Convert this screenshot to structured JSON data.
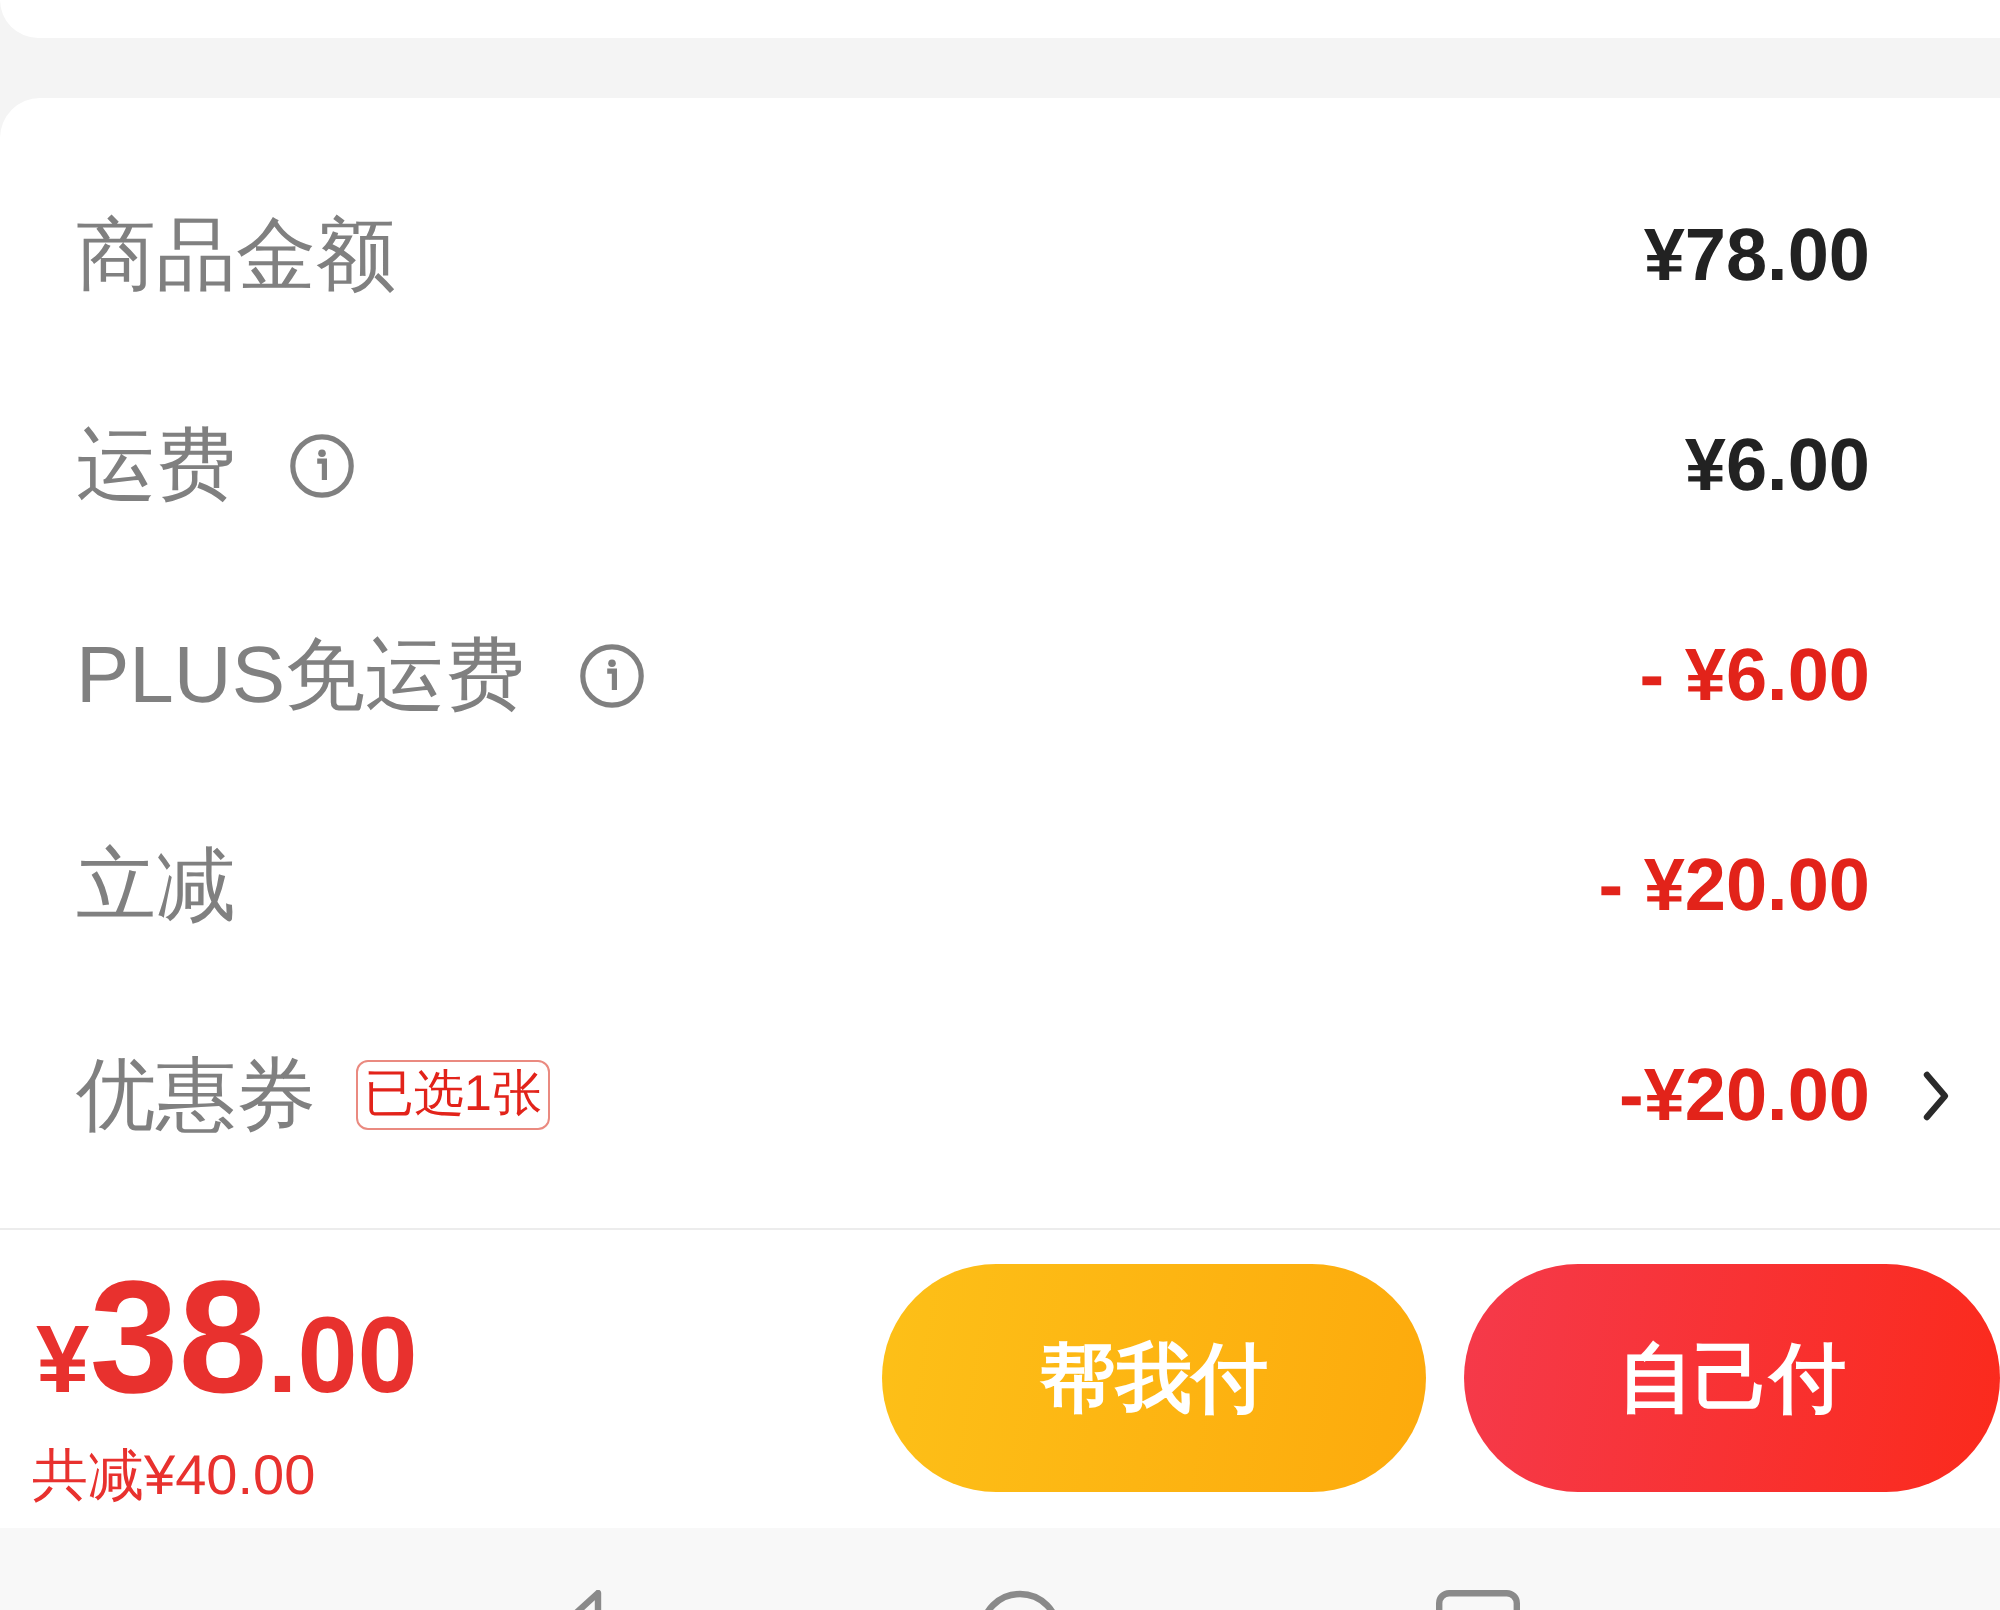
{
  "summary": {
    "rows": [
      {
        "label": "商品金额",
        "info": false,
        "value": "¥78.00",
        "kind": "amount",
        "arrow": false
      },
      {
        "label": "运费",
        "info": true,
        "value": "¥6.00",
        "kind": "amount",
        "arrow": false
      },
      {
        "label": "PLUS免运费",
        "info": true,
        "value": "- ¥6.00",
        "kind": "deduction",
        "arrow": false
      },
      {
        "label": "立减",
        "info": false,
        "value": "- ¥20.00",
        "kind": "deduction",
        "arrow": false
      },
      {
        "label": "优惠券",
        "info": false,
        "badge": "已选1张",
        "value": "-¥20.00",
        "kind": "deduction",
        "arrow": true
      }
    ]
  },
  "checkout": {
    "total": {
      "currency": "¥",
      "integer": "38",
      "decimals": ".00"
    },
    "saving": "共减¥40.00",
    "buttons": [
      {
        "label": "帮我付",
        "kind": "secondary"
      },
      {
        "label": "自己付",
        "kind": "primary"
      }
    ]
  }
}
